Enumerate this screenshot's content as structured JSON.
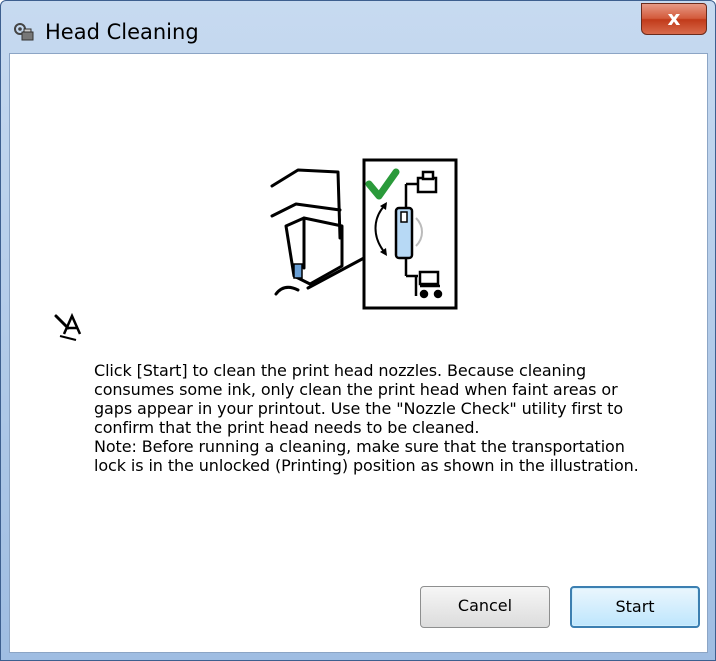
{
  "window": {
    "title": "Head Cleaning",
    "close_label": "x"
  },
  "icons": {
    "title_icon": "printer-gear-icon",
    "side_icon": "printer-head-pen-icon",
    "illustration": "transport-lock-unlocked-illustration"
  },
  "content": {
    "paragraph1": "Click [Start] to clean the print head nozzles. Because cleaning consumes some ink, only clean the print head when faint areas or gaps appear in your printout. Use the \"Nozzle Check\" utility first to confirm that the print head needs to be cleaned.",
    "paragraph2": "Note: Before running a cleaning, make sure that the transportation lock is in the unlocked (Printing) position as shown in the illustration."
  },
  "buttons": {
    "cancel_label": "Cancel",
    "start_label": "Start"
  },
  "colors": {
    "title_bar": "#b9d1ea",
    "close_button": "#c8452a",
    "check_mark": "#2a9a3a",
    "default_button_border": "#3c7fb1"
  }
}
